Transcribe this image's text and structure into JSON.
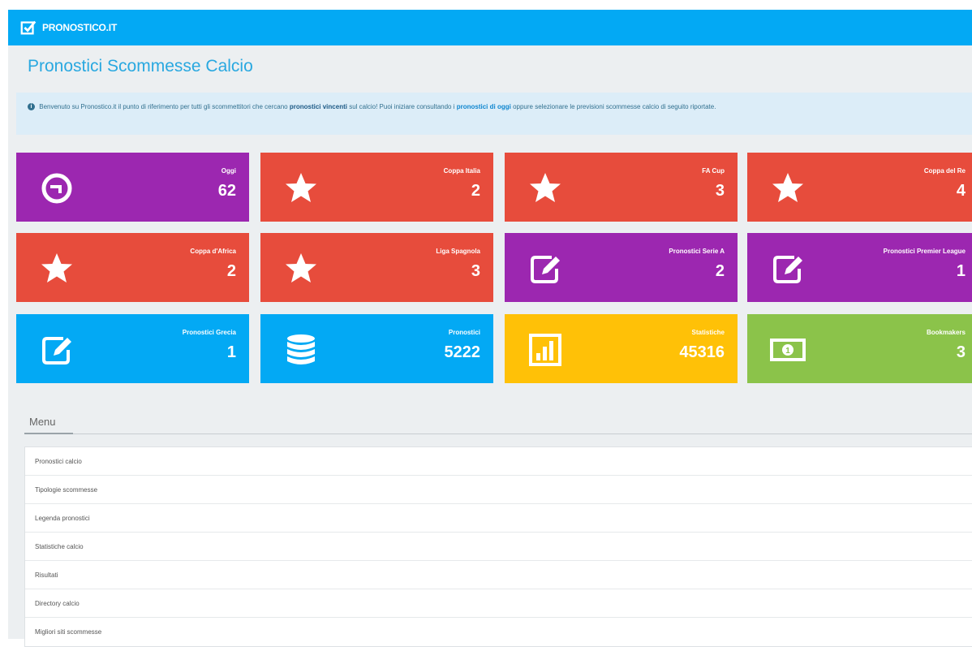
{
  "header": {
    "logo_text": "PRONOSTICO.IT"
  },
  "page": {
    "title": "Pronostici Scommesse Calcio"
  },
  "intro": {
    "part1": "Benvenuto su Pronostico.it il punto di riferimento per tutti gli scommettitori che cercano",
    "bold1": "pronostici vincenti",
    "part2": "sul calcio! Puoi iniziare consultando i",
    "link1": "pronostici di oggi",
    "part3": "oppure selezionare le previsioni scommesse calcio di seguito riportate."
  },
  "tiles": [
    {
      "label": "Oggi",
      "value": "62",
      "color": "#9c27b0",
      "icon": "clock-icon"
    },
    {
      "label": "Coppa Italia",
      "value": "2",
      "color": "#e74c3c",
      "icon": "star-icon"
    },
    {
      "label": "FA Cup",
      "value": "3",
      "color": "#e74c3c",
      "icon": "star-icon"
    },
    {
      "label": "Coppa del Re",
      "value": "4",
      "color": "#e74c3c",
      "icon": "star-icon"
    },
    {
      "label": "Coppa d'Africa",
      "value": "2",
      "color": "#e74c3c",
      "icon": "star-icon"
    },
    {
      "label": "Liga Spagnola",
      "value": "3",
      "color": "#e74c3c",
      "icon": "star-icon"
    },
    {
      "label": "Pronostici Serie A",
      "value": "2",
      "color": "#9c27b0",
      "icon": "edit-icon"
    },
    {
      "label": "Pronostici Premier League",
      "value": "1",
      "color": "#9c27b0",
      "icon": "edit-icon"
    },
    {
      "label": "Pronostici Grecia",
      "value": "1",
      "color": "#03a9f4",
      "icon": "edit-icon"
    },
    {
      "label": "Pronostici",
      "value": "5222",
      "color": "#03a9f4",
      "icon": "database-icon"
    },
    {
      "label": "Statistiche",
      "value": "45316",
      "color": "#ffc107",
      "icon": "bar-chart-icon"
    },
    {
      "label": "Bookmakers",
      "value": "3",
      "color": "#8bc34a",
      "icon": "money-icon"
    }
  ],
  "menu": {
    "title": "Menu",
    "items": [
      "Pronostici calcio",
      "Tipologie scommesse",
      "Legenda pronostici",
      "Statistiche calcio",
      "Risultati",
      "Directory calcio",
      "Migliori siti scommesse"
    ]
  }
}
